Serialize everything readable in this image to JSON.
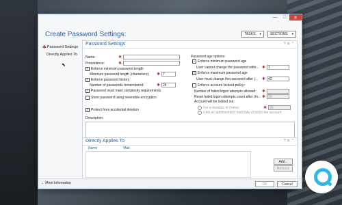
{
  "window": {
    "title": "Create Password Settings:",
    "controls": {
      "minimize": "—",
      "maximize": "□",
      "close": "✕"
    },
    "tasks_label": "TASKS",
    "sections_label": "SECTIONS"
  },
  "nav": {
    "items": [
      {
        "label": "Password Settings",
        "required_marker": "✱"
      },
      {
        "label": "Directly Applies To"
      }
    ]
  },
  "password_settings": {
    "title": "Password Settings",
    "name_label": "Name:",
    "name_value": "",
    "precedence_label": "Precedence:",
    "precedence_value": "",
    "enforce_min_length": {
      "label": "Enforce minimum password length",
      "checked": true
    },
    "min_length_label": "Minimum password length (characters):",
    "min_length_value": "7",
    "enforce_history": {
      "label": "Enforce password history",
      "checked": true
    },
    "history_label": "Number of passwords remembered:",
    "history_value": "24",
    "complexity": {
      "label": "Password must meet complexity requirements",
      "checked": true
    },
    "reversible": {
      "label": "Store password using reversible encryption",
      "checked": false
    },
    "protect": {
      "label": "Protect from accidental deletion",
      "checked": true
    },
    "description_label": "Description:",
    "age_options_label": "Password age options:",
    "enforce_min_age": {
      "label": "Enforce minimum password age",
      "checked": true
    },
    "min_age_label": "User cannot change the password withi...",
    "min_age_value": "1",
    "enforce_max_age": {
      "label": "Enforce maximum password age",
      "checked": true
    },
    "max_age_label": "User must change the password after (...",
    "max_age_value": "42",
    "lockout": {
      "label": "Enforce account lockout policy:",
      "checked": false
    },
    "failed_attempts_label": "Number of failed logon attempts allowed:",
    "failed_attempts_value": "",
    "reset_label": "Reset failed logon attempts count after (m...",
    "reset_value": "30",
    "locked_out_label": "Account will be locked out:",
    "duration_label": "For a duration of (mins):",
    "duration_value": "30",
    "until_unlock_label": "Until an administrator manually unlocks the account"
  },
  "directly_applies": {
    "title": "Directly Applies To",
    "col_name": "Name",
    "col_mail": "Mail",
    "add_label": "Add...",
    "remove_label": "Remove"
  },
  "footer": {
    "more_info": "More Information",
    "ok": "OK",
    "cancel": "Cancel"
  },
  "colors": {
    "accent": "#2a5d9f",
    "required": "#c0392b",
    "logo": "#2fb8e6"
  }
}
